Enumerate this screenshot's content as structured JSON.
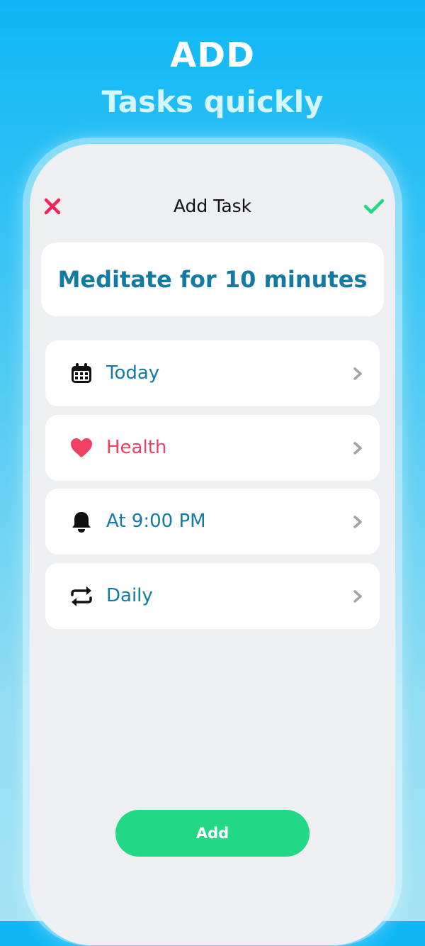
{
  "promo": {
    "title": "ADD",
    "subtitle": "Tasks quickly"
  },
  "header": {
    "title": "Add Task",
    "close_icon": "close-x-icon",
    "confirm_icon": "checkmark-icon"
  },
  "task": {
    "name": "Meditate for 10 minutes"
  },
  "options": [
    {
      "icon": "calendar-icon",
      "label": "Today",
      "color": "#137aa3"
    },
    {
      "icon": "heart-icon",
      "label": "Health",
      "color": "#ef3f63"
    },
    {
      "icon": "bell-icon",
      "label": "At 9:00 PM",
      "color": "#137aa3"
    },
    {
      "icon": "repeat-icon",
      "label": "Daily",
      "color": "#137aa3"
    }
  ],
  "add_button": {
    "label": "Add"
  },
  "colors": {
    "accent_blue": "#137aa3",
    "close_red": "#f0245a",
    "confirm_green": "#23d884",
    "health_red": "#ef3f63"
  }
}
